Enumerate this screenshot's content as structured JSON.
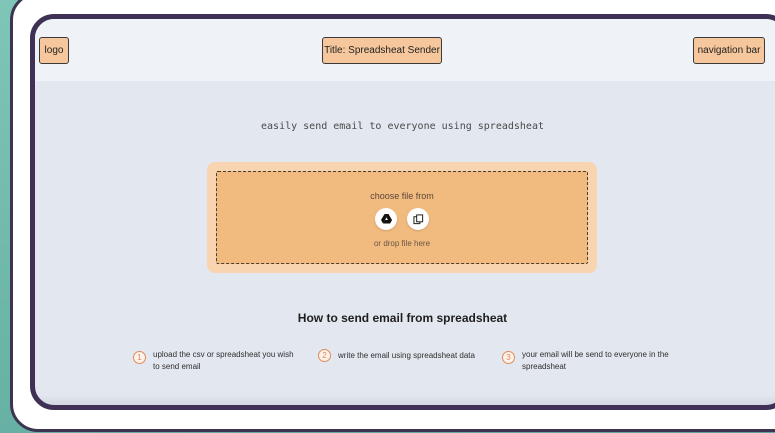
{
  "header": {
    "logo_label": "logo",
    "title_label": "Title: Spreadsheat Sender",
    "nav_label": "navigation bar"
  },
  "hero": {
    "tagline": "easily send email to everyone using spreadsheat"
  },
  "upload": {
    "choose_label": "choose file from",
    "drop_label": "or drop file here",
    "icons": [
      "google-drive-icon",
      "copy-file-icon"
    ]
  },
  "how_to": {
    "title": "How to send email from spreadsheat",
    "steps": [
      {
        "number": "1",
        "text": "upload the csv or spreadsheat you wish to send email"
      },
      {
        "number": "2",
        "text": "write the email using spreadsheat data"
      },
      {
        "number": "3",
        "text": "your email will be send to everyone in the spreadsheat"
      }
    ]
  },
  "colors": {
    "accent": "#f1bb80",
    "header_box": "#f6c79c",
    "frame_border": "#3e3155",
    "step_accent": "#e08a5a"
  }
}
